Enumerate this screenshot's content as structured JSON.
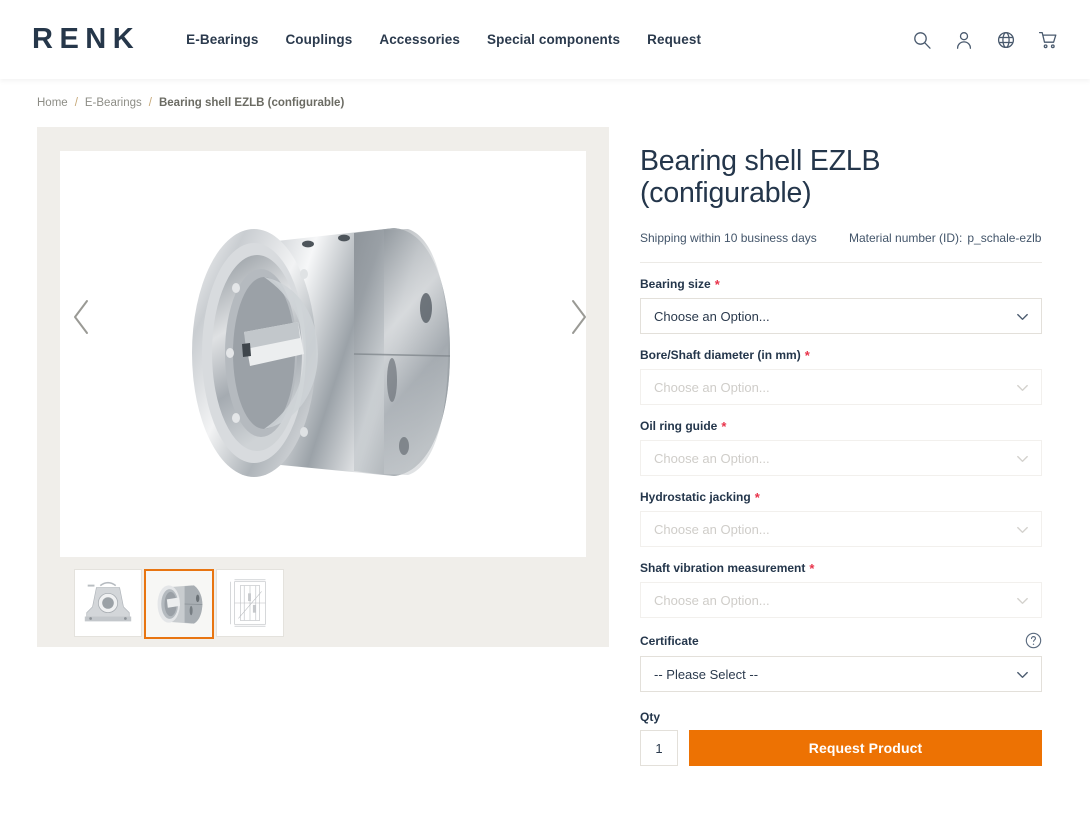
{
  "header": {
    "logo": "RENK",
    "nav": [
      {
        "label": "E-Bearings"
      },
      {
        "label": "Couplings"
      },
      {
        "label": "Accessories"
      },
      {
        "label": "Special components"
      },
      {
        "label": "Request"
      }
    ],
    "icons": [
      {
        "name": "search-icon"
      },
      {
        "name": "account-icon"
      },
      {
        "name": "globe-icon"
      },
      {
        "name": "cart-icon"
      }
    ]
  },
  "breadcrumb": {
    "items": [
      {
        "label": "Home"
      },
      {
        "label": "E-Bearings"
      }
    ],
    "separator": "/",
    "current": "Bearing shell EZLB (configurable)"
  },
  "gallery": {
    "prev_label": "‹",
    "next_label": "›",
    "thumbnails": [
      {
        "name": "thumb-pillow-block-housing",
        "selected": false
      },
      {
        "name": "thumb-bearing-shell",
        "selected": true
      },
      {
        "name": "thumb-technical-drawing",
        "selected": false
      }
    ],
    "main_image_alt": "Bearing shell EZLB"
  },
  "product": {
    "title": "Bearing shell EZLB (configurable)",
    "shipping": "Shipping within 10 business days",
    "material_number_label": "Material number (ID):",
    "material_number_value": "p_schale-ezlb"
  },
  "options": [
    {
      "label": "Bearing size",
      "required": true,
      "value": "Choose an Option...",
      "disabled": false,
      "help": false
    },
    {
      "label": "Bore/Shaft diameter (in mm)",
      "required": true,
      "value": "Choose an Option...",
      "disabled": true,
      "help": false
    },
    {
      "label": "Oil ring guide",
      "required": true,
      "value": "Choose an Option...",
      "disabled": true,
      "help": false
    },
    {
      "label": "Hydrostatic jacking",
      "required": true,
      "value": "Choose an Option...",
      "disabled": true,
      "help": false
    },
    {
      "label": "Shaft vibration measurement",
      "required": true,
      "value": "Choose an Option...",
      "disabled": true,
      "help": false
    },
    {
      "label": "Certificate",
      "required": false,
      "value": "-- Please Select --",
      "disabled": false,
      "help": true
    }
  ],
  "purchase": {
    "qty_label": "Qty",
    "qty_value": "1",
    "submit_label": "Request Product"
  },
  "colors": {
    "brand_navy": "#26374a",
    "accent_orange": "#ed7203",
    "required_red": "#e8334a",
    "breadcrumb_sep": "#c6a878",
    "gallery_bg": "#f0eeea"
  }
}
